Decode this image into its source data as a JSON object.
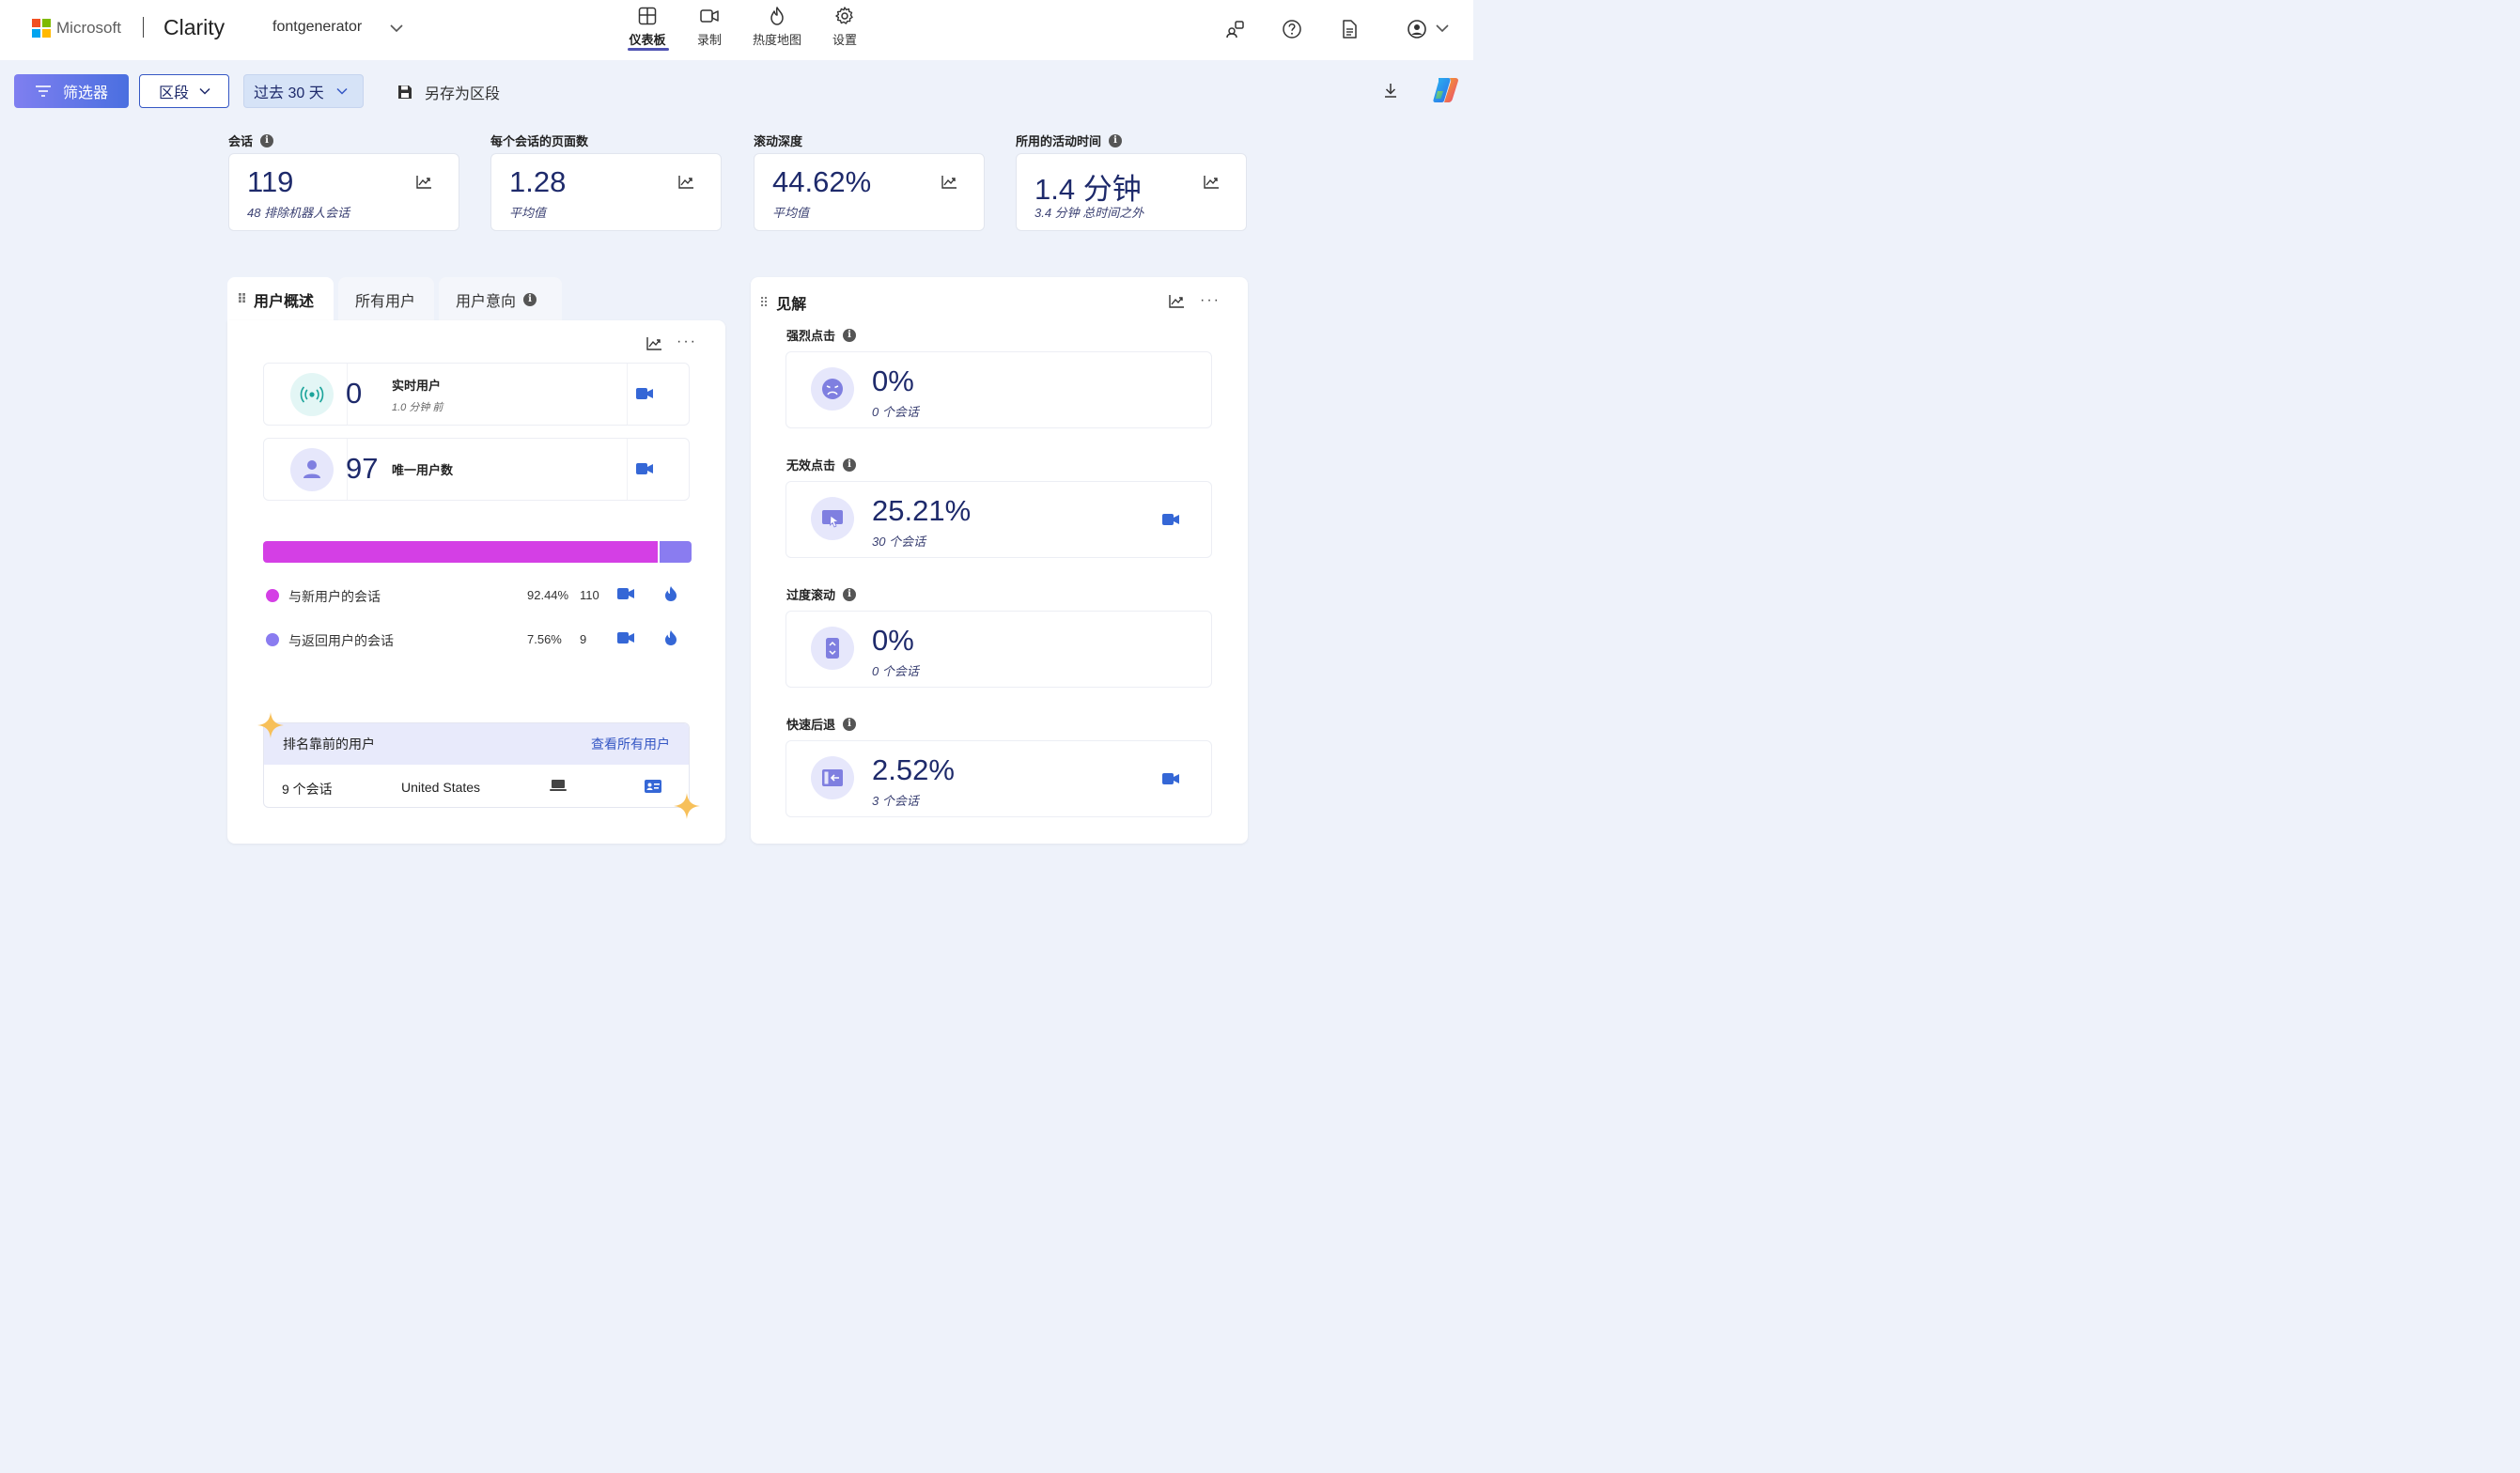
{
  "header": {
    "brand": "Microsoft",
    "product": "Clarity",
    "project": "fontgenerator",
    "nav": [
      {
        "label": "仪表板",
        "icon": "dashboard-icon",
        "active": true
      },
      {
        "label": "录制",
        "icon": "recording-icon",
        "active": false
      },
      {
        "label": "热度地图",
        "icon": "heatmap-icon",
        "active": false
      },
      {
        "label": "设置",
        "icon": "settings-icon",
        "active": false
      }
    ],
    "icons": [
      "share-icon",
      "help-icon",
      "document-icon",
      "account-icon"
    ]
  },
  "toolbar": {
    "filter_label": "筛选器",
    "segment_label": "区段",
    "date_label": "过去 30 天",
    "save_segment_label": "另存为区段"
  },
  "metrics": [
    {
      "label": "会话",
      "has_info": true,
      "value": "119",
      "sub": "48 排除机器人会话"
    },
    {
      "label": "每个会话的页面数",
      "has_info": false,
      "value": "1.28",
      "sub": "平均值"
    },
    {
      "label": "滚动深度",
      "has_info": false,
      "value": "44.62%",
      "sub": "平均值"
    },
    {
      "label": "所用的活动时间",
      "has_info": true,
      "value": "1.4 分钟",
      "sub": "3.4 分钟 总时间之外"
    }
  ],
  "user_panel": {
    "tabs": [
      "用户概述",
      "所有用户",
      "用户意向"
    ],
    "live_users": {
      "value": "0",
      "label": "实时用户",
      "sub": "1.0 分钟 前"
    },
    "unique_users": {
      "value": "97",
      "label": "唯一用户数"
    },
    "split": {
      "new_fraction": 0.9244,
      "returning_fraction": 0.0756
    },
    "legend": [
      {
        "name": "与新用户的会话",
        "pct": "92.44%",
        "count": "110",
        "color": "#d43fe5"
      },
      {
        "name": "与返回用户的会话",
        "pct": "7.56%",
        "count": "9",
        "color": "#8a7cf0"
      }
    ],
    "top_users": {
      "title": "排名靠前的用户",
      "link": "查看所有用户",
      "row": {
        "sessions": "9 个会话",
        "country": "United States"
      }
    }
  },
  "insights": {
    "title": "见解",
    "items": [
      {
        "label": "强烈点击",
        "value": "0%",
        "sub": "0 个会话",
        "has_recording": false,
        "icon": "angry-face-icon"
      },
      {
        "label": "无效点击",
        "value": "25.21%",
        "sub": "30 个会话",
        "has_recording": true,
        "icon": "dead-click-icon"
      },
      {
        "label": "过度滚动",
        "value": "0%",
        "sub": "0 个会话",
        "has_recording": false,
        "icon": "scroll-icon"
      },
      {
        "label": "快速后退",
        "value": "2.52%",
        "sub": "3 个会话",
        "has_recording": true,
        "icon": "quick-back-icon"
      }
    ]
  },
  "colors": {
    "accent": "#4f52b2",
    "navy": "#1e2a6b",
    "new_users": "#d43fe5",
    "returning_users": "#8a7cf0",
    "recording_icon": "#3567d6"
  }
}
